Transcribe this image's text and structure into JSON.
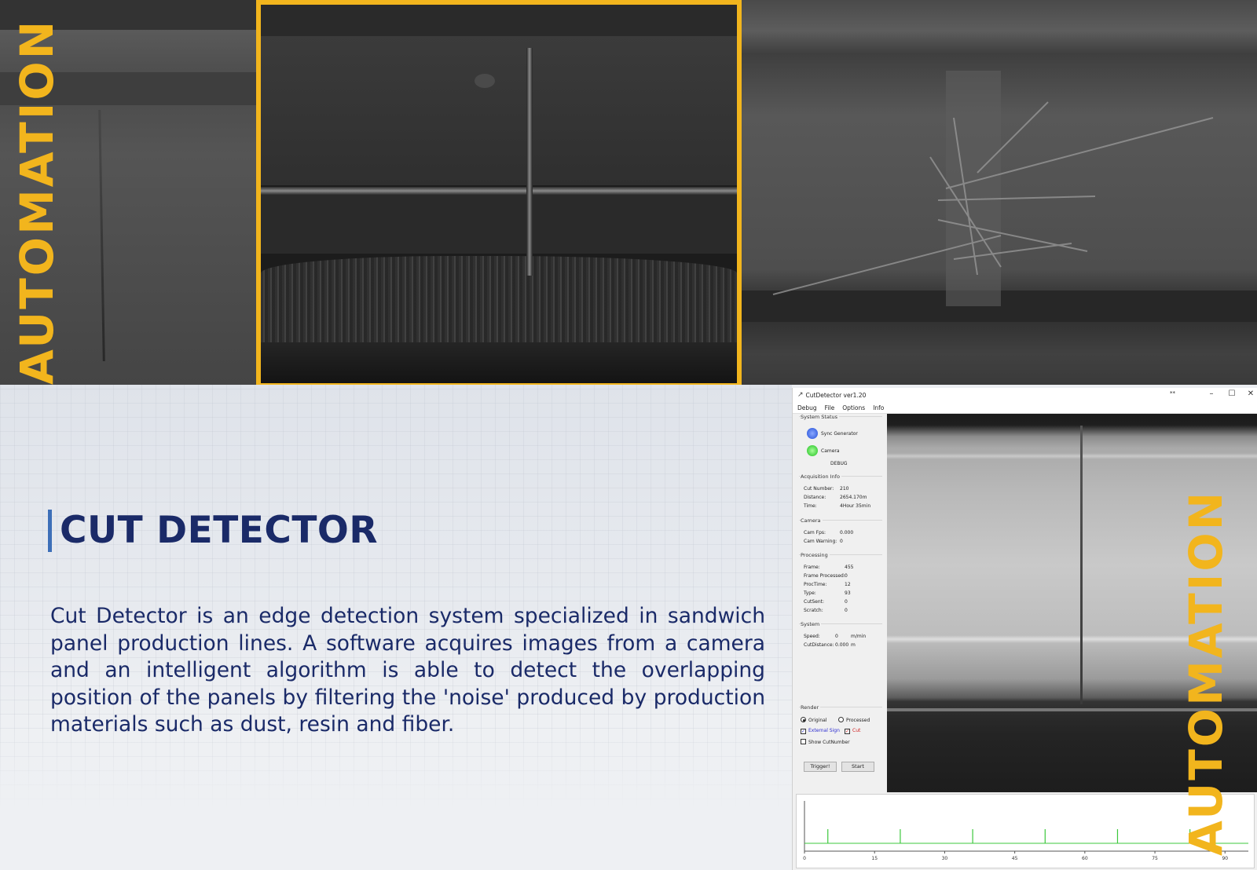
{
  "brand": {
    "vertical_text": "AUTOMATION",
    "accent_color": "#f2b51d"
  },
  "section": {
    "title": "CUT DETECTOR",
    "description": "Cut Detector is an edge detection system specialized in sandwich panel production lines. A software acquires images from a camera and an intelligent algorithm is able to detect the overlapping position of the panels by filtering the 'noise' produced by production materials such as dust, resin and fiber."
  },
  "app": {
    "window_title": "CutDetector ver1.20",
    "extra": "**",
    "window_buttons": [
      "–",
      "☐",
      "✕"
    ],
    "menu": [
      "Debug",
      "File",
      "Options",
      "Info"
    ],
    "system_status": {
      "title": "System Status",
      "sync_label": "Sync Generator",
      "camera_label": "Camera",
      "mode": "DEBUG"
    },
    "acquisition": {
      "title": "Acquisition Info",
      "rows": [
        {
          "label": "Cut Number:",
          "value": "210"
        },
        {
          "label": "Distance:",
          "value": "2654.170m"
        },
        {
          "label": "Time:",
          "value": "4Hour 35min"
        }
      ]
    },
    "camera": {
      "title": "Camera",
      "rows": [
        {
          "label": "Cam Fps:",
          "value": "0.000"
        },
        {
          "label": "Cam Warning:",
          "value": "0"
        }
      ]
    },
    "processing": {
      "title": "Processing",
      "rows": [
        {
          "label": "Frame:",
          "value": "455"
        },
        {
          "label": "Frame Processed:",
          "value": "0"
        },
        {
          "label": "ProcTime:",
          "value": "12"
        },
        {
          "label": "Type:",
          "value": "93"
        },
        {
          "label": "CutSent:",
          "value": "0"
        },
        {
          "label": "Scratch:",
          "value": "0"
        }
      ]
    },
    "system": {
      "title": "System",
      "rows": [
        {
          "label": "Speed:",
          "value": "0",
          "unit": "m/min"
        },
        {
          "label": "CutDistance:",
          "value": "0.000",
          "unit": "m"
        }
      ]
    },
    "render": {
      "title": "Render",
      "original": "Original",
      "processed": "Processed",
      "external_sign": "External Sign",
      "cut": "Cut",
      "show_cutnumber": "Show CutNumber"
    },
    "buttons": {
      "trigger": "Trigger!",
      "start": "Start"
    }
  },
  "chart_data": {
    "type": "line",
    "x_ticks": [
      "0",
      "15",
      "30",
      "45",
      "60",
      "75",
      "90"
    ],
    "xlim": [
      0,
      95
    ],
    "series": [
      {
        "x": [
          5,
          20.5,
          36,
          51.5,
          67,
          82.5
        ],
        "y": [
          1,
          1,
          1,
          1,
          1,
          1
        ]
      }
    ],
    "line_color": "#3cc83c",
    "grid": false
  }
}
